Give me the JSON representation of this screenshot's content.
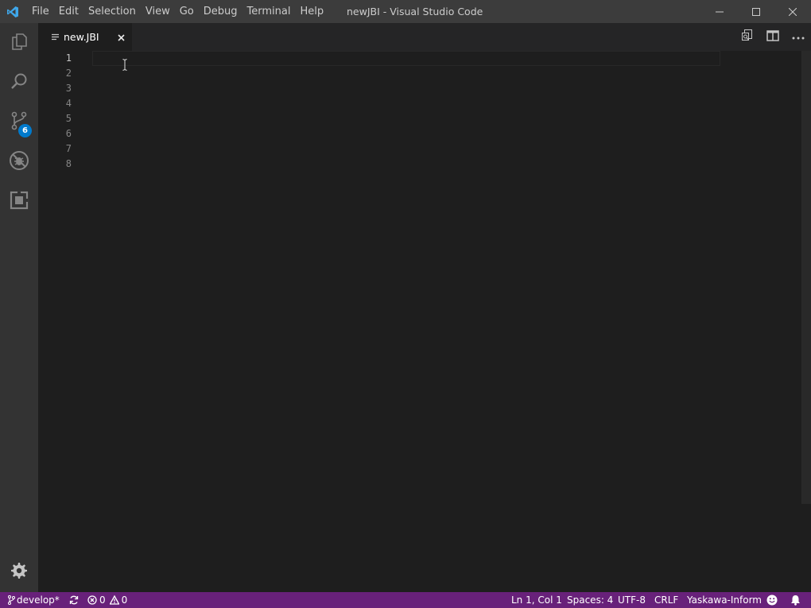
{
  "window": {
    "title": "newJBI - Visual Studio Code",
    "app_icon": "vscode-logo-icon",
    "controls": [
      "minimize-icon",
      "maximize-icon",
      "close-icon"
    ]
  },
  "menu": [
    "File",
    "Edit",
    "Selection",
    "View",
    "Go",
    "Debug",
    "Terminal",
    "Help"
  ],
  "activity_bar": {
    "items": [
      {
        "name": "explorer",
        "icon": "files-icon"
      },
      {
        "name": "search",
        "icon": "search-icon"
      },
      {
        "name": "source-control",
        "icon": "source-control-icon",
        "badge": "6"
      },
      {
        "name": "debug",
        "icon": "debug-icon"
      },
      {
        "name": "extensions",
        "icon": "extensions-icon"
      }
    ],
    "bottom": {
      "name": "manage",
      "icon": "gear-icon"
    }
  },
  "tab": {
    "label": "new.JBI",
    "icon": "lines-icon",
    "close": "×"
  },
  "editor_actions": [
    "open-changes-icon",
    "split-editor-icon",
    "more-actions-icon"
  ],
  "editor": {
    "line_numbers": [
      "1",
      "2",
      "3",
      "4",
      "5",
      "6",
      "7",
      "8"
    ],
    "active_line": 1
  },
  "status_bar": {
    "branch": "develop*",
    "errors": "0",
    "warnings": "0",
    "position": "Ln 1, Col 1",
    "spaces": "Spaces: 4",
    "encoding": "UTF-8",
    "eol": "CRLF",
    "language": "Yaskawa-Inform",
    "background": "#68217a"
  },
  "colors": {
    "titlebar": "#3c3c3c",
    "activitybar": "#333333",
    "editor": "#1e1e1e",
    "badge": "#007acc"
  }
}
